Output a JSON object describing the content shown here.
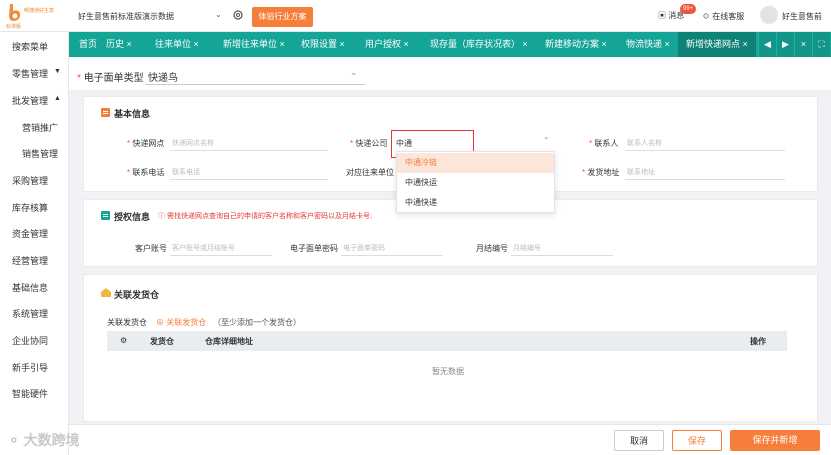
{
  "top": {
    "logo_text": "畅捷通好生意",
    "logo_sub": "标准版",
    "company": "好生意售前标准版演示数据",
    "trial_button": "体验行业方案",
    "messages_label": "消息",
    "messages_badge": "99+",
    "service_label": "在线客服",
    "user_name": "好生意售前"
  },
  "sidebar": {
    "items": [
      "搜索菜单",
      "零售管理",
      "批发管理",
      "营销推广",
      "销售管理",
      "采购管理",
      "库存核算",
      "资金管理",
      "经营管理",
      "基础信息",
      "系统管理",
      "企业协同",
      "新手引导",
      "智能硬件"
    ]
  },
  "tabs": [
    "首页",
    "历史",
    "往来单位",
    "新增往来单位",
    "权限设置",
    "用户授权",
    "现存量（库存状况表）",
    "新建移动方案",
    "物流快递",
    "新增快递网点"
  ],
  "header": {
    "label": "电子面单类型",
    "value": "快递鸟"
  },
  "basic": {
    "title": "基本信息",
    "express_point_label": "快递网点",
    "express_point_placeholder": "快递网点名称",
    "express_company_label": "快递公司",
    "express_company_value": "中通",
    "contact_label": "联系人",
    "contact_placeholder": "联系人名称",
    "phone_label": "联系电话",
    "phone_placeholder": "联系电话",
    "partner_label": "对应往来单位",
    "address_label": "发货地址",
    "address_placeholder": "联系地址",
    "options": [
      "中通冷链",
      "中通快运",
      "中通快递"
    ]
  },
  "auth": {
    "title": "授权信息",
    "notice": "需找快递网点查询自己的申请的客户名称和客户密码以及月结卡号;",
    "account_label": "客户账号",
    "account_placeholder": "客户账号或月结账号",
    "password_label": "电子面单密码",
    "password_placeholder": "电子面单密码",
    "monthly_label": "月结编号",
    "monthly_placeholder": "月结编号"
  },
  "warehouse": {
    "title": "关联发货仓",
    "label": "关联发货仓",
    "link": "关联发货仓",
    "hint": "（至少添加一个发货仓）",
    "columns": [
      "发货仓",
      "仓库详细地址",
      "操作"
    ],
    "empty": "暂无数据"
  },
  "footer": {
    "cancel": "取消",
    "save": "保存",
    "save_new": "保存并新增",
    "watermark": "大数跨境"
  }
}
